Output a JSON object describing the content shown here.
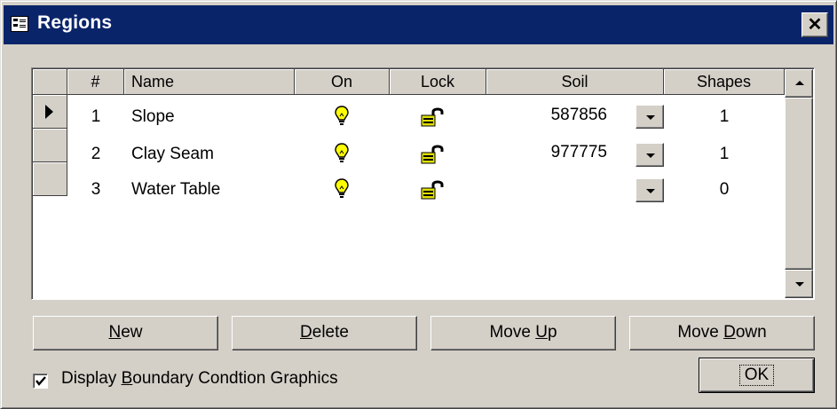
{
  "window": {
    "title": "Regions",
    "close_glyph": "✕"
  },
  "grid": {
    "headers": {
      "num": "#",
      "name": "Name",
      "on": "On",
      "lock": "Lock",
      "soil": "Soil",
      "shapes": "Shapes"
    },
    "rows": [
      {
        "num": "1",
        "name": "Slope",
        "on": "lightbulb-icon",
        "lock": "unlocked-padlock-icon",
        "soil": "587856",
        "shapes": "1",
        "selected": true
      },
      {
        "num": "2",
        "name": "Clay Seam",
        "on": "lightbulb-icon",
        "lock": "unlocked-padlock-icon",
        "soil": "977775",
        "shapes": "1"
      },
      {
        "num": "3",
        "name": "Water Table",
        "on": "lightbulb-icon",
        "lock": "unlocked-padlock-icon",
        "soil": "",
        "shapes": "0"
      }
    ]
  },
  "buttons": {
    "new": {
      "pre": "",
      "mnemonic": "N",
      "post": "ew"
    },
    "delete": {
      "pre": "",
      "mnemonic": "D",
      "post": "elete"
    },
    "move_up": {
      "pre": "Move ",
      "mnemonic": "U",
      "post": "p"
    },
    "move_down": {
      "pre": "Move ",
      "mnemonic": "D",
      "post": "own"
    },
    "ok": "OK"
  },
  "options": {
    "display_bc": {
      "checked": true,
      "pre": "Display ",
      "mnemonic": "B",
      "post": "oundary Condtion Graphics"
    }
  },
  "colors": {
    "titlebar": "#0a246a",
    "face": "#d4d0c8",
    "bulb": "#ffff00",
    "lock": "#e0e000"
  }
}
